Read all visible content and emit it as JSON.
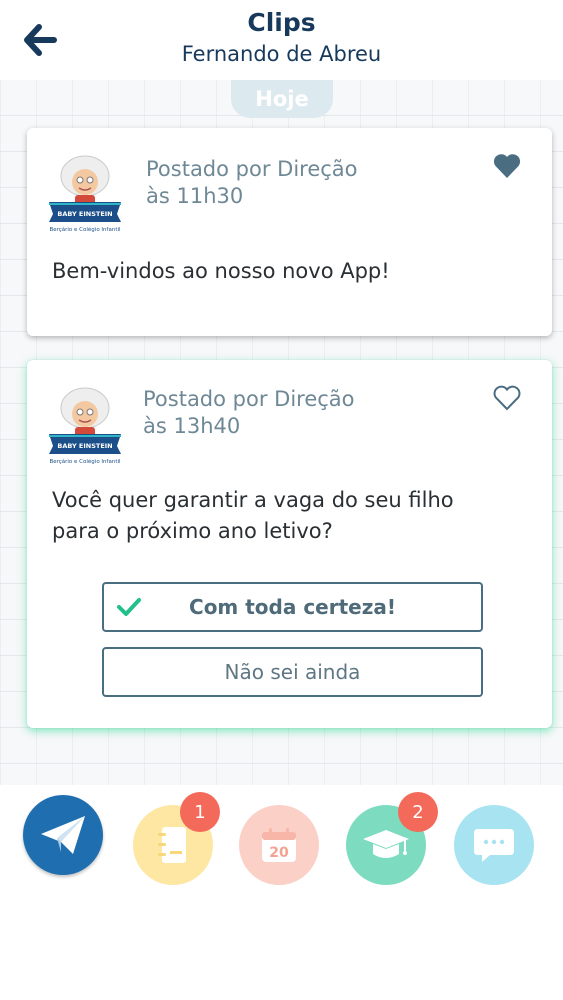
{
  "header": {
    "title": "Clips",
    "subtitle": "Fernando de Abreu",
    "back_icon": "arrow-left-icon"
  },
  "feed": {
    "date_label": "Hoje",
    "posts": [
      {
        "posted_by": "Postado por Direção",
        "time": "às 11h30",
        "message": "Bem-vindos ao nosso novo App!",
        "liked": true,
        "logo_text": {
          "brand": "BABY EINSTEIN",
          "tagline": "Berçário e Colégio Infantil"
        }
      },
      {
        "posted_by": "Postado por Direção",
        "time": "às 13h40",
        "message_line1": "Você quer garantir a vaga do seu filho",
        "message_line2": "para o próximo ano letivo?",
        "liked": false,
        "logo_text": {
          "brand": "BABY EINSTEIN",
          "tagline": "Berçário e Colégio Infantil"
        },
        "options": [
          {
            "label": "Com toda certeza!",
            "selected": true
          },
          {
            "label": "Não sei ainda",
            "selected": false
          }
        ]
      }
    ]
  },
  "nav": {
    "items": [
      {
        "icon": "paper-plane-icon",
        "color": "#1f6fb0"
      },
      {
        "icon": "notebook-icon",
        "color": "#fde7a3",
        "badge": "1"
      },
      {
        "icon": "calendar-icon",
        "color": "#fbd0c6",
        "calendar_day": "20"
      },
      {
        "icon": "graduation-cap-icon",
        "color": "#7ddcc0",
        "badge": "2"
      },
      {
        "icon": "chat-bubble-icon",
        "color": "#a8e3f2"
      }
    ]
  },
  "colors": {
    "header_text": "#173a5c",
    "heart": "#4b6d82",
    "check": "#22c08a",
    "badge": "#f36a5a",
    "card2_glow": "#40daa0"
  }
}
